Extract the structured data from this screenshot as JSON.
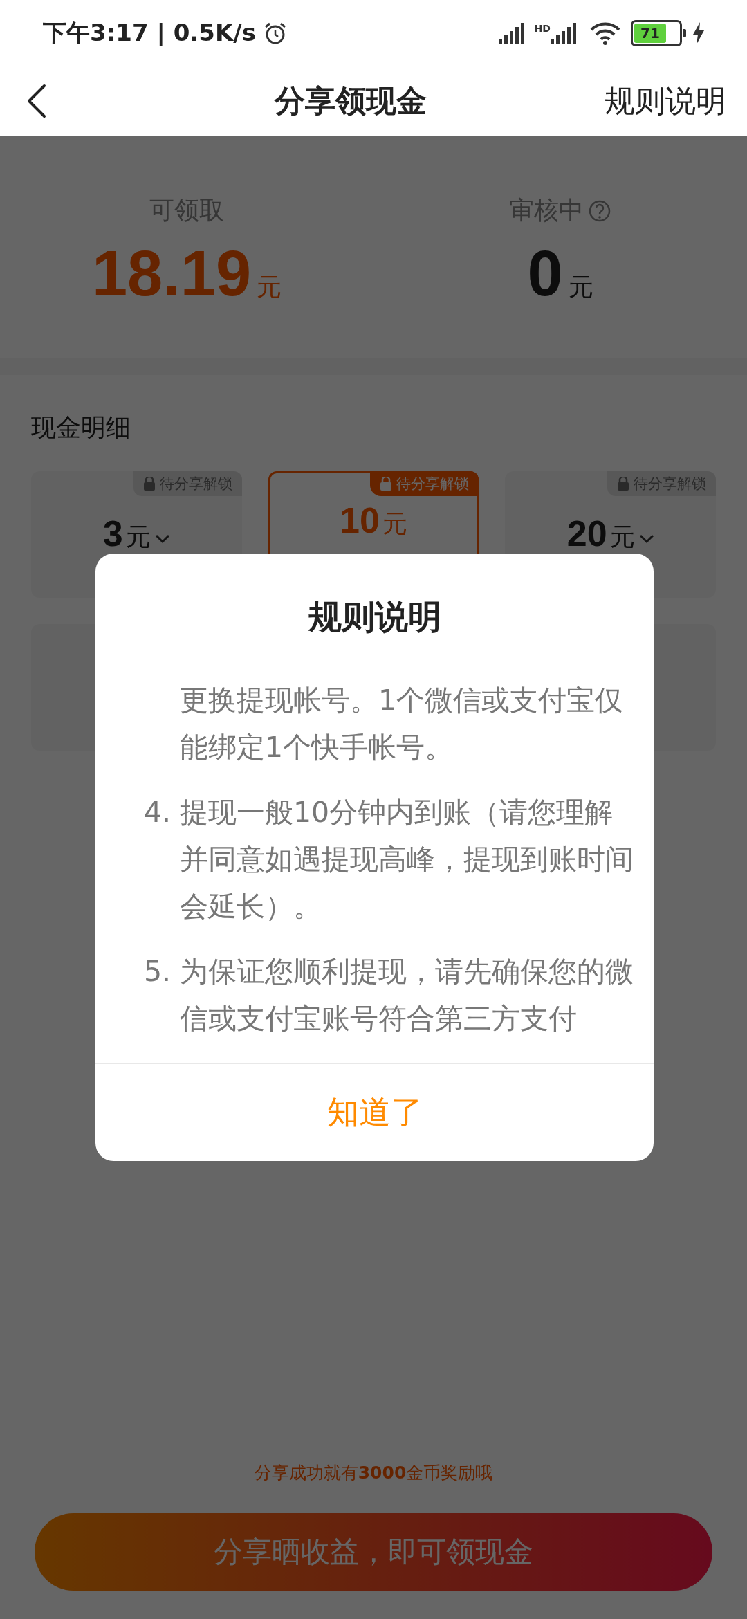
{
  "status_bar": {
    "time": "下午3:17 | 0.5K/s",
    "network_label": "HD",
    "battery_text": "71"
  },
  "nav": {
    "title": "分享领现金",
    "action": "规则说明"
  },
  "summary": [
    {
      "label": "可领取",
      "amount": "18.19",
      "unit": "元",
      "highlight": true,
      "help": false
    },
    {
      "label": "审核中",
      "amount": "0",
      "unit": "元",
      "highlight": false,
      "help": true
    }
  ],
  "details": {
    "title": "现金明细",
    "cards": [
      {
        "amount": "3",
        "unit": "元",
        "tag": "待分享解锁",
        "selected": false
      },
      {
        "amount": "10",
        "unit": "元",
        "tag": "待分享解锁",
        "selected": true
      },
      {
        "amount": "20",
        "unit": "元",
        "tag": "待分享解锁",
        "selected": false
      }
    ]
  },
  "hint": "分享成功就有**3000**金币奖励哦",
  "share_button": "分享晒收益，即可领现金",
  "dialog": {
    "title": "规则说明",
    "items": [
      {
        "text": "更换提现帐号。1个微信或支付宝仅能绑定1个快手帐号。"
      },
      {
        "number": "4.",
        "text": "提现一般10分钟内到账（请您理解并同意如遇提现高峰，提现到账时间会延长）。"
      },
      {
        "number": "5.",
        "text": "为保证您顺利提现，请先确保您的微信或支付宝账号符合第三方支付"
      }
    ],
    "button": "知道了"
  }
}
